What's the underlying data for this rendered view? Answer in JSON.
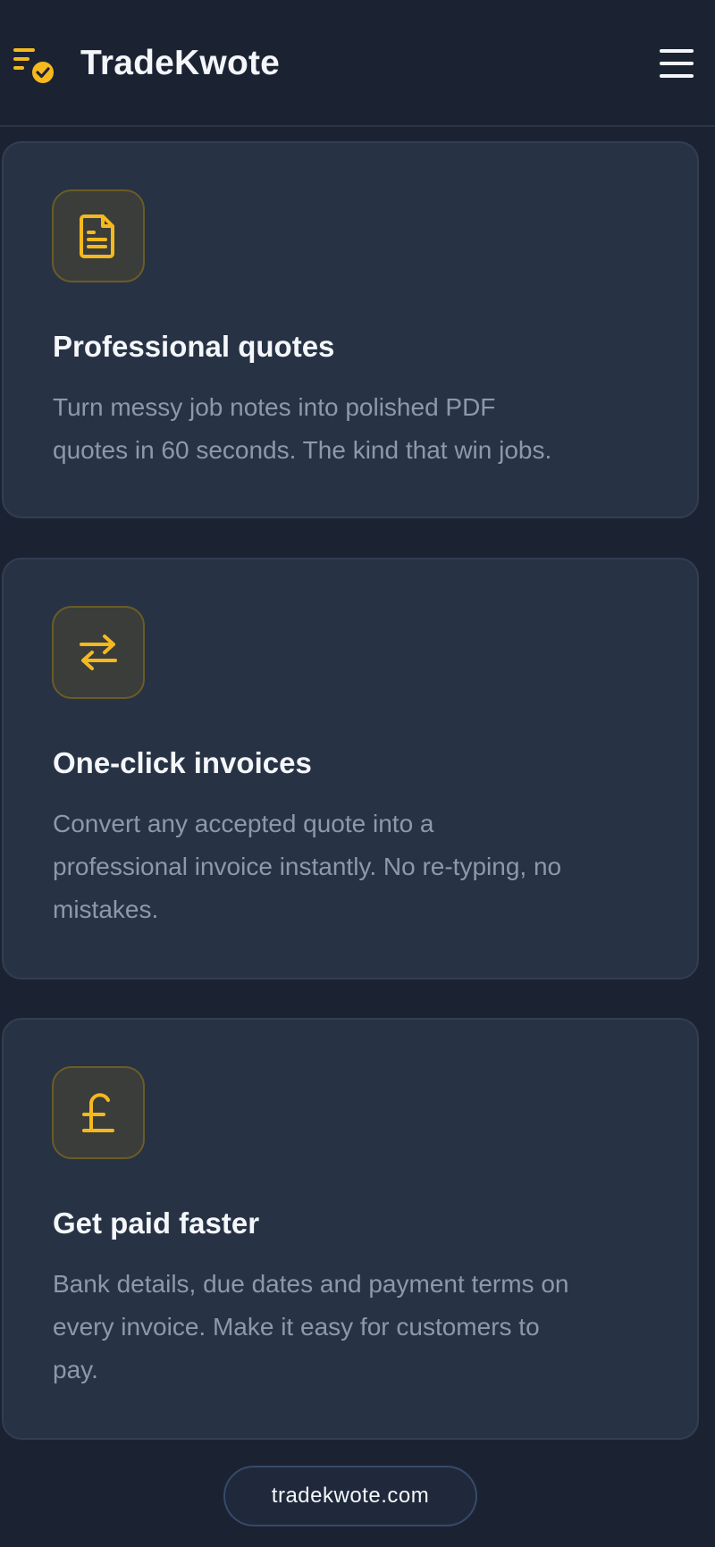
{
  "header": {
    "brand": "TradeKwote",
    "logo_icon": "list-check-icon",
    "menu_icon": "hamburger-menu-icon"
  },
  "colors": {
    "background": "#1b2333",
    "card": "#273345",
    "accent": "#f5b91e",
    "title": "#f4f6fa",
    "muted": "#8e98a8"
  },
  "features": [
    {
      "icon": "document-icon",
      "title": "Professional quotes",
      "desc_lines": [
        "Turn messy job notes into polished PDF",
        "quotes in 60 seconds. The kind that win jobs."
      ]
    },
    {
      "icon": "exchange-arrows-icon",
      "title": "One-click invoices",
      "desc_lines": [
        "Convert any accepted quote into a",
        "professional invoice instantly. No re-typing, no",
        "mistakes."
      ]
    },
    {
      "icon": "pound-sign-icon",
      "title": "Get paid faster",
      "desc_lines": [
        "Bank details, due dates and payment terms on",
        "every invoice. Make it easy for customers to",
        "pay."
      ]
    }
  ],
  "footer": {
    "link": "tradekwote.com"
  }
}
